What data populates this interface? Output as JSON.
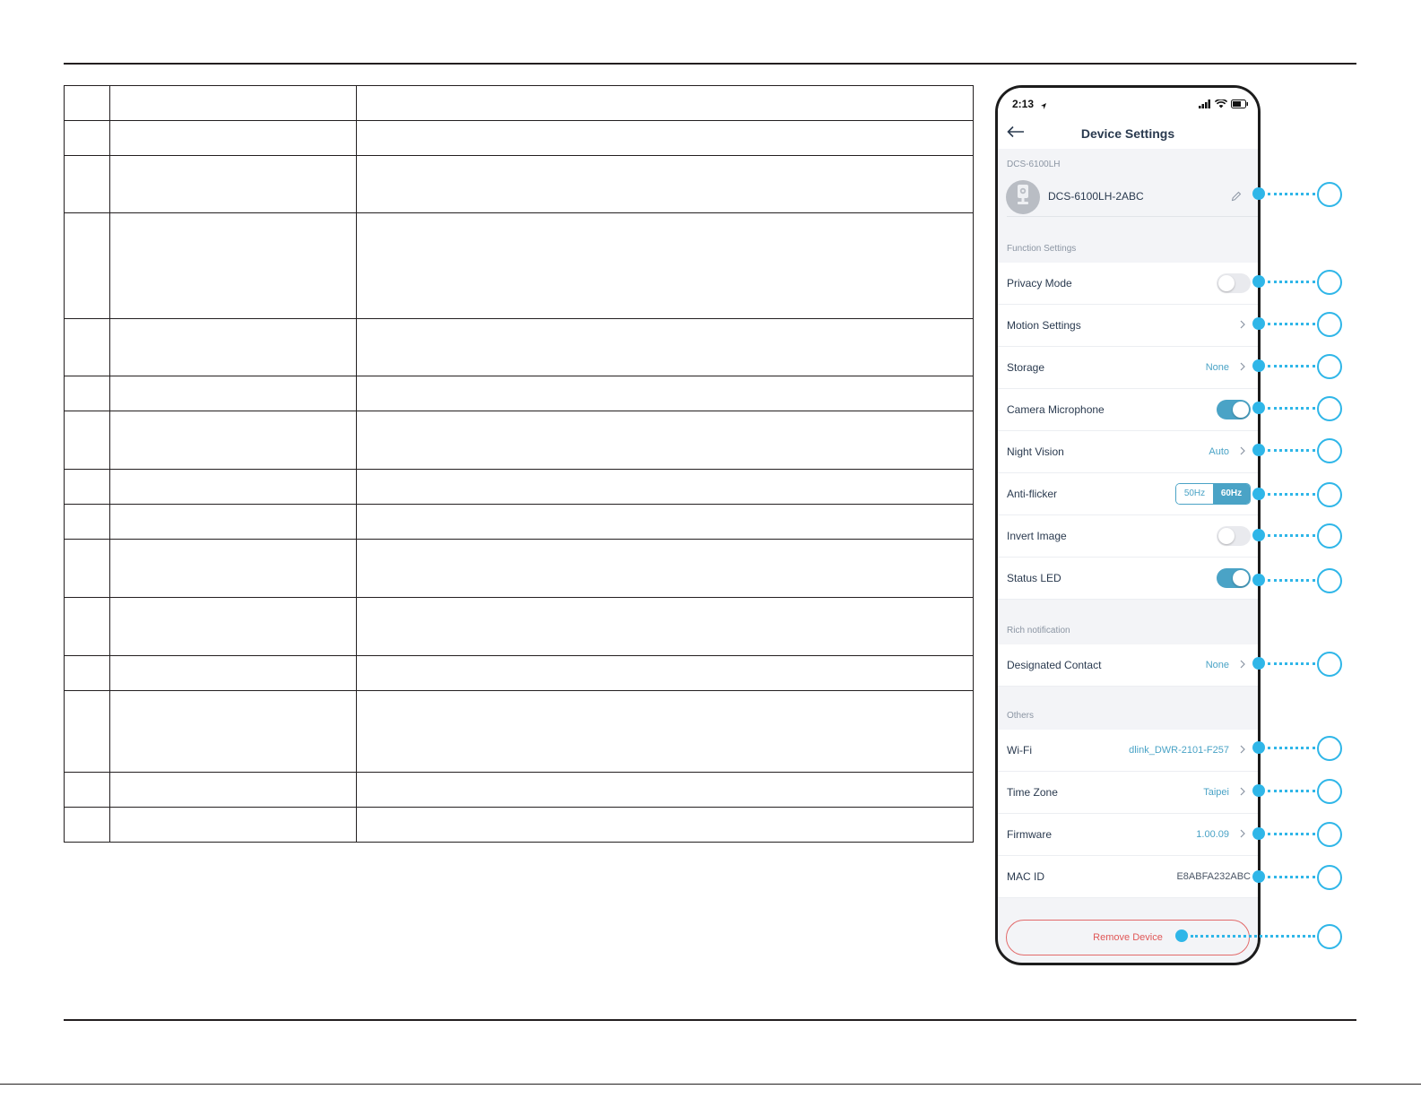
{
  "status_bar": {
    "time": "2:13"
  },
  "nav": {
    "title": "Device Settings"
  },
  "device": {
    "section_label": "DCS-6100LH",
    "name": "DCS-6100LH-2ABC"
  },
  "function_settings": {
    "section_label": "Function Settings",
    "privacy_mode": {
      "label": "Privacy Mode",
      "enabled": false
    },
    "motion_settings": {
      "label": "Motion Settings"
    },
    "storage": {
      "label": "Storage",
      "value": "None"
    },
    "camera_microphone": {
      "label": "Camera Microphone",
      "enabled": true
    },
    "night_vision": {
      "label": "Night Vision",
      "value": "Auto"
    },
    "anti_flicker": {
      "label": "Anti-flicker",
      "options": [
        "50Hz",
        "60Hz"
      ],
      "selected": "60Hz"
    },
    "invert_image": {
      "label": "Invert Image",
      "enabled": false
    },
    "status_led": {
      "label": "Status LED",
      "enabled": true
    }
  },
  "rich_notification": {
    "section_label": "Rich notification",
    "designated_contact": {
      "label": "Designated Contact",
      "value": "None"
    }
  },
  "others": {
    "section_label": "Others",
    "wifi": {
      "label": "Wi-Fi",
      "value": "dlink_DWR-2101-F257"
    },
    "time_zone": {
      "label": "Time Zone",
      "value": "Taipei"
    },
    "firmware": {
      "label": "Firmware",
      "value": "1.00.09"
    },
    "mac_id": {
      "label": "MAC ID",
      "value": "E8ABFA232ABC"
    }
  },
  "remove_device": {
    "label": "Remove Device"
  },
  "colors": {
    "accent": "#4aa3c6",
    "callout": "#2fb6e8",
    "danger": "#e05757"
  }
}
